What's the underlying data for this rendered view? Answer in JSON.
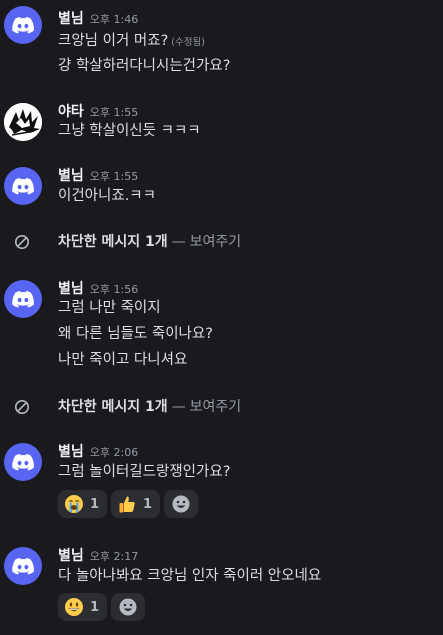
{
  "colors": {
    "background": "#1a1a1e",
    "blurple": "#5865f2",
    "text": "#dbdee1",
    "muted": "#949ba4",
    "reaction_bg": "#2b2d31"
  },
  "messages": [
    {
      "username": "별님",
      "timestamp": "오후 1:46",
      "avatar_icon": "discord-logo-icon",
      "lines": [
        "크앙님 이거 머죠?",
        "걍  학살하러다니시는건가요?"
      ],
      "edited_label": "(수정됨)"
    },
    {
      "username": "야타",
      "timestamp": "오후 1:55",
      "avatar_icon": "custom-black-white-avatar",
      "lines": [
        "그냥 학살이신듯 ㅋㅋㅋ"
      ]
    },
    {
      "username": "별님",
      "timestamp": "오후 1:55",
      "avatar_icon": "discord-logo-icon",
      "lines": [
        "이건아니죠.ㅋㅋ"
      ]
    },
    {
      "username": "별님",
      "timestamp": "오후 1:56",
      "avatar_icon": "discord-logo-icon",
      "lines": [
        "그럼 나만 죽이지",
        "왜 다른 님들도 죽이나요?",
        "나만 죽이고 다니셔요"
      ]
    },
    {
      "username": "별님",
      "timestamp": "오후 2:06",
      "avatar_icon": "discord-logo-icon",
      "lines": [
        "그럼 놀이터길드랑쟁인가요?"
      ],
      "reactions": [
        {
          "emoji": "loudly-crying-face-icon",
          "count": "1"
        },
        {
          "emoji": "thumbs-up-icon",
          "count": "1"
        }
      ]
    },
    {
      "username": "별님",
      "timestamp": "오후 2:17",
      "avatar_icon": "discord-logo-icon",
      "lines": [
        "다 놀아나봐요  크앙님 인자 죽이러 안오네요"
      ],
      "reactions": [
        {
          "emoji": "grinning-face-icon",
          "count": "1"
        }
      ]
    }
  ],
  "blocked_notices": [
    {
      "text": "차단한 메시지 1개",
      "separator": "—",
      "action": "보여주기",
      "icon": "blocked-circle-icon"
    },
    {
      "text": "차단한 메시지 1개",
      "separator": "—",
      "action": "보여주기",
      "icon": "blocked-circle-icon"
    }
  ],
  "add_reaction_icon": "add-reaction-smiley-icon"
}
